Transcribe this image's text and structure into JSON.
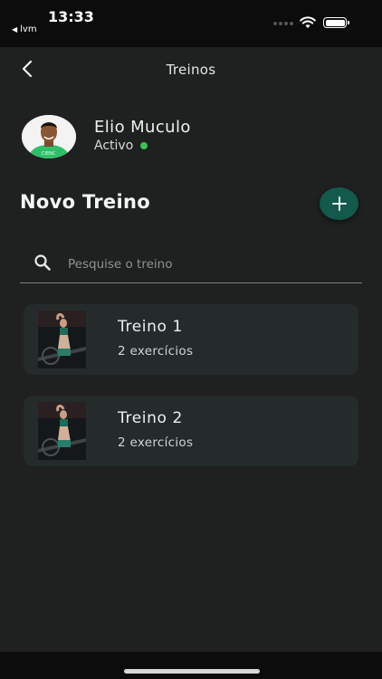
{
  "status_bar": {
    "time": "13:33",
    "back_app": "lvm"
  },
  "nav": {
    "title": "Treinos"
  },
  "profile": {
    "name": "Elio Muculo",
    "status": "Activo",
    "status_color": "#3cc157"
  },
  "section": {
    "title": "Novo Treino",
    "add_icon": "plus-icon",
    "accent": "#13594c"
  },
  "search": {
    "placeholder": "Pesquise o treino",
    "value": ""
  },
  "workouts": [
    {
      "title": "Treino 1",
      "subtitle": "2 exercícios"
    },
    {
      "title": "Treino 2",
      "subtitle": "2 exercícios"
    }
  ]
}
